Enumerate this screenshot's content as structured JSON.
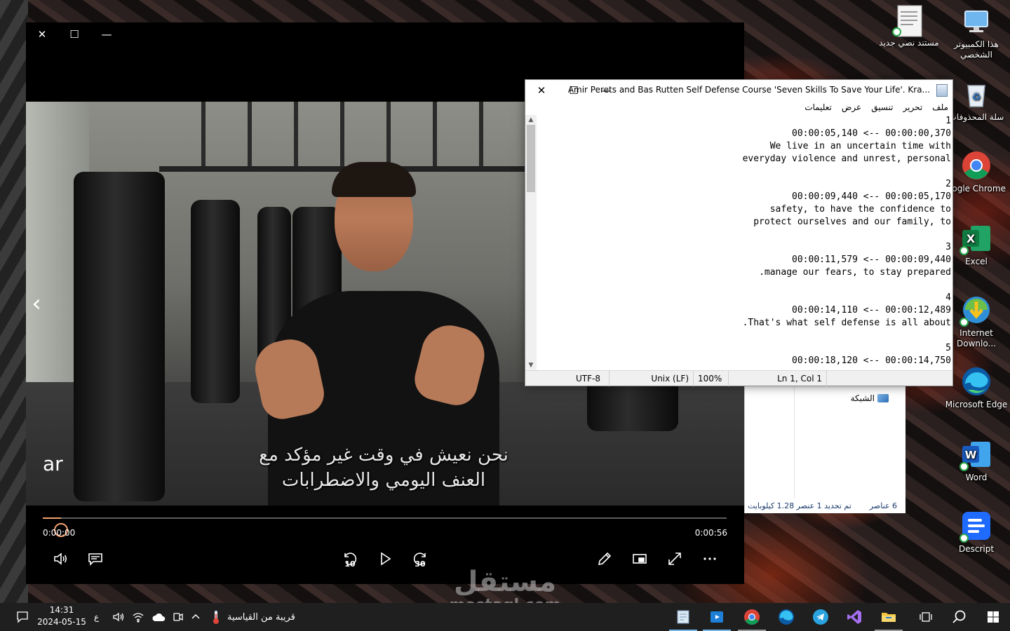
{
  "desktop": {
    "icons": [
      {
        "name": "this-pc",
        "label": "هذا الكمبيوتر الشخصي"
      },
      {
        "name": "new-text-doc",
        "label": "مستند نصي جديد"
      },
      {
        "name": "recycle-bin",
        "label": "سلة المحذوفات"
      },
      {
        "name": "google-chrome",
        "label": "oogle Chrome"
      },
      {
        "name": "excel",
        "label": "Excel"
      },
      {
        "name": "internet-download-manager",
        "label": "Internet Downlo..."
      },
      {
        "name": "microsoft-edge",
        "label": "Microsoft Edge"
      },
      {
        "name": "word",
        "label": "Word"
      },
      {
        "name": "descript",
        "label": "Descript"
      }
    ]
  },
  "player": {
    "close": "✕",
    "maximize": "☐",
    "minimize": "—",
    "lang_tag": "ar",
    "subtitle_line1": "نحن نعيش في وقت غير مؤكد مع",
    "subtitle_line2": "العنف اليومي والاضطرابات",
    "time_current": "0:00:00",
    "time_total": "0:00:56",
    "progress": 0.027,
    "skip_back": "10",
    "skip_forward": "30"
  },
  "notepad": {
    "title": "Amir Perets and Bas Rutten Self Defense Course 'Seven Skills To Save Your Life'. Kra...",
    "close": "✕",
    "maximize": "☐",
    "minimize": "—",
    "menu": [
      "ملف",
      "تحرير",
      "تنسيق",
      "عرض",
      "تعليمات"
    ],
    "lines": [
      "1",
      "00:00:05,140 <-- 00:00:00,370",
      "We live in an uncertain time with",
      "everyday violence and unrest, personal",
      "",
      "2",
      "00:00:09,440 <-- 00:00:05,170",
      "safety, to have the confidence to",
      "protect ourselves and our family, to",
      "",
      "3",
      "00:00:11,579 <-- 00:00:09,440",
      ".manage our fears, to stay prepared",
      "",
      "4",
      "00:00:14,110 <-- 00:00:12,489",
      ".That's what self defense is all about",
      "",
      "5",
      "00:00:18,120 <-- 00:00:14,750"
    ],
    "status": {
      "encoding": "UTF-8",
      "line_endings": "Unix (LF)",
      "zoom": "100%",
      "position": "Ln 1, Col 1"
    }
  },
  "explorer": {
    "network_label": "الشبكة",
    "items_count": "6 عناصر",
    "selected_info": "تم تحديد 1 عنصر  1.28 كيلوبايت"
  },
  "watermark": {
    "arabic": "مستقل",
    "latin": "mostaql.com"
  },
  "taskbar": {
    "time": "14:31",
    "date": "2024-05-15",
    "input_lang": "ع",
    "weather": "قريبة من القياسية"
  }
}
